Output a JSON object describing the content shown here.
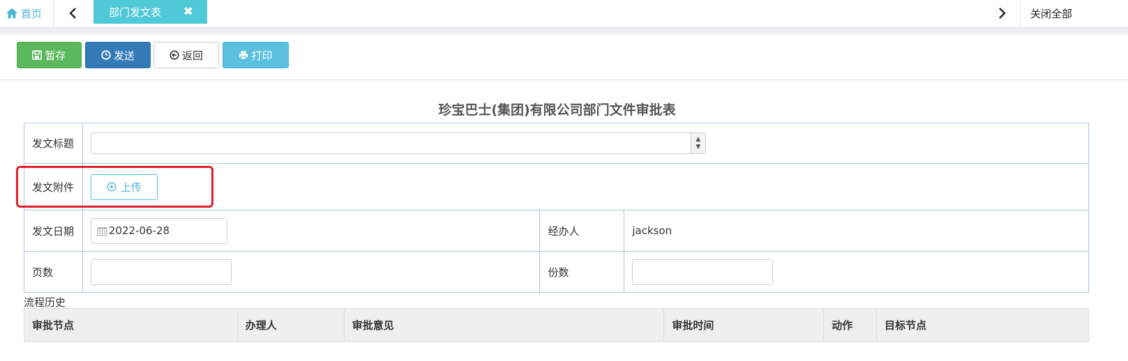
{
  "tabs": {
    "home_label": "首页",
    "active_tab": "部门发文表",
    "close_all": "关闭全部"
  },
  "toolbar": {
    "save": "暂存",
    "send": "发送",
    "back": "返回",
    "print": "打印"
  },
  "form": {
    "title": "珍宝巴士(集团)有限公司部门文件审批表",
    "doc_title_label": "发文标题",
    "doc_title_value": "",
    "attachment_label": "发文附件",
    "upload_label": "上传",
    "date_label": "发文日期",
    "date_value": "2022-06-28",
    "handler_label": "经办人",
    "handler_value": "jackson",
    "pages_label": "页数",
    "pages_value": "",
    "copies_label": "份数",
    "copies_value": ""
  },
  "history": {
    "label": "流程历史",
    "columns": [
      "审批节点",
      "办理人",
      "审批意见",
      "审批时间",
      "动作",
      "目标节点"
    ]
  },
  "colors": {
    "tab_active": "#4fc8d7",
    "save_green": "#5cb85c",
    "send_blue": "#337ab7",
    "print_cyan": "#5bc0de",
    "highlight_red": "#e0202a"
  }
}
